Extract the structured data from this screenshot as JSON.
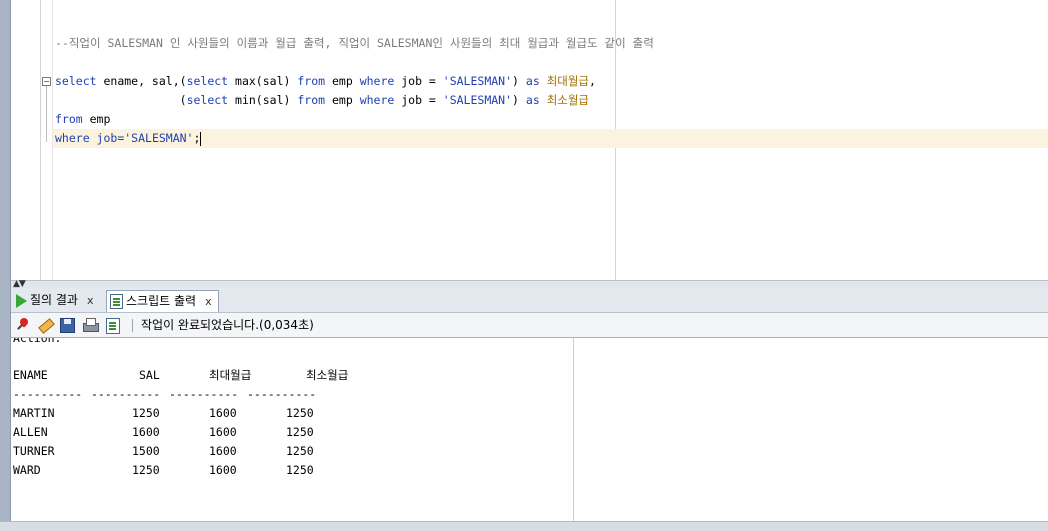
{
  "editor": {
    "comment": "--직업이 SALESMAN 인 사원들의 이름과 월급 출력, 직업이 SALESMAN인 사원들의 최대 월급과 월급도 같이 출력",
    "line1": {
      "kw_select": "select",
      "cols": " ename, sal,(",
      "kw_select2": "select",
      "fn_max": " max(sal) ",
      "kw_from": "from",
      "t1": " emp ",
      "kw_where": "where",
      "t2": " job = ",
      "str": "'SALESMAN'",
      "t3": ") ",
      "kw_as": "as",
      "sp": " ",
      "alias": "최대월급",
      "tail": ","
    },
    "line2": {
      "indent": "                  (",
      "kw_select": "select",
      "fn_min": " min(sal) ",
      "kw_from": "from",
      "t1": " emp ",
      "kw_where": "where",
      "t2": " job = ",
      "str": "'SALESMAN'",
      "t3": ") ",
      "kw_as": "as",
      "sp": " ",
      "alias": "최소월급"
    },
    "line3": {
      "kw_from": "from",
      "t1": " emp"
    },
    "line4": {
      "kw_where": "where",
      "t1": " job=",
      "str": "'SALESMAN'",
      "tail": ";"
    },
    "fold_symbol": "−"
  },
  "splitter": {
    "arrows": "▲▼"
  },
  "tabs": [
    {
      "label": "질의 결과",
      "close": "x",
      "icon": "run-icon"
    },
    {
      "label": "스크립트 출력",
      "close": "x",
      "icon": "script-output-icon"
    }
  ],
  "toolbar": {
    "status": "작업이 완료되었습니다.(0,034초)",
    "icons": [
      "pin-icon",
      "eraser-icon",
      "save-icon",
      "print-icon",
      "script-doc-icon"
    ]
  },
  "output": {
    "partial_top": "Action:",
    "headers": [
      "ENAME",
      "SAL",
      "최대월급",
      "최소월급"
    ],
    "separator": [
      "----------",
      "----------",
      "----------",
      "----------"
    ],
    "rows": [
      [
        "MARTIN",
        "1250",
        "1600",
        "1250"
      ],
      [
        "ALLEN",
        "1600",
        "1600",
        "1250"
      ],
      [
        "TURNER",
        "1500",
        "1600",
        "1250"
      ],
      [
        "WARD",
        "1250",
        "1600",
        "1250"
      ]
    ]
  }
}
